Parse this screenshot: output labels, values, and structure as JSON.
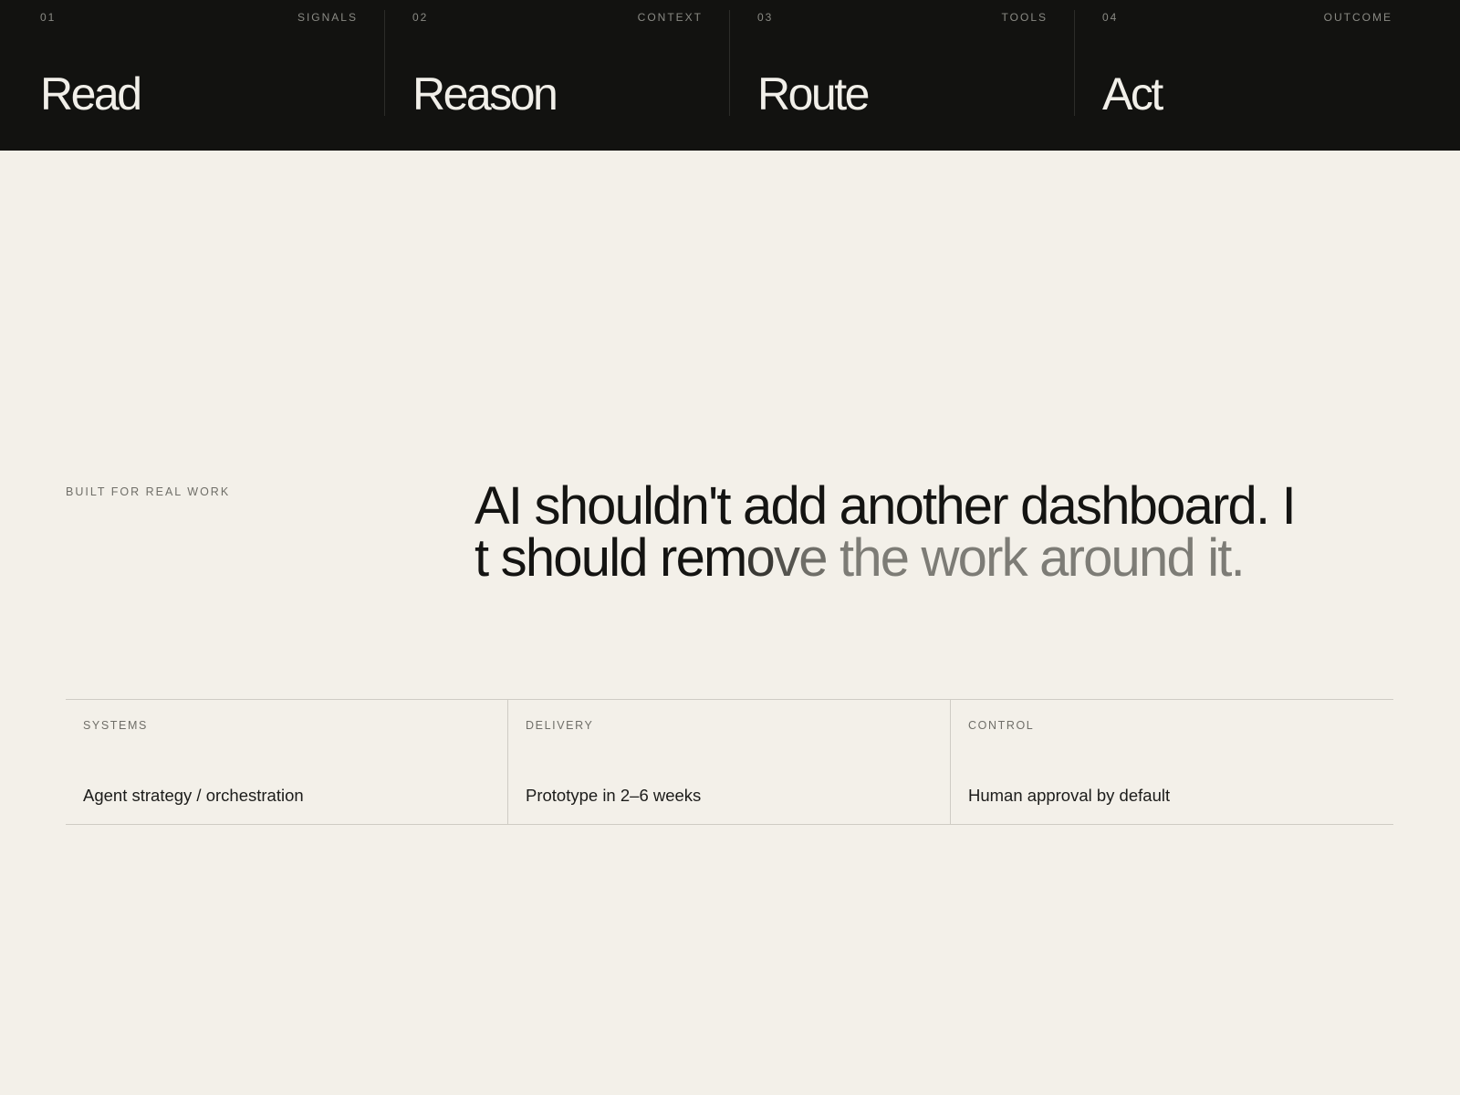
{
  "steps": [
    {
      "num": "01",
      "tag": "SIGNALS",
      "title": "Read"
    },
    {
      "num": "02",
      "tag": "CONTEXT",
      "title": "Reason"
    },
    {
      "num": "03",
      "tag": "TOOLS",
      "title": "Route"
    },
    {
      "num": "04",
      "tag": "OUTCOME",
      "title": "Act"
    }
  ],
  "intro": {
    "eyebrow": "BUILT FOR REAL WORK",
    "headline": {
      "line1": "AI shouldn't add another dashboard. I",
      "line2_dark": "t should rem",
      "line2_fade1": "o",
      "line2_fade2": "v",
      "line2_fade3": "e ",
      "line2_muted": "the work around it."
    }
  },
  "features": [
    {
      "label": "SYSTEMS",
      "value": "Agent strategy / orchestration"
    },
    {
      "label": "DELIVERY",
      "value": "Prototype in 2–6 weeks"
    },
    {
      "label": "CONTROL",
      "value": "Human approval by default"
    }
  ],
  "colors": {
    "topbar_bg": "#121210",
    "page_bg": "#f3f0e9",
    "text_primary": "#141412",
    "text_muted": "#7d7c76"
  }
}
